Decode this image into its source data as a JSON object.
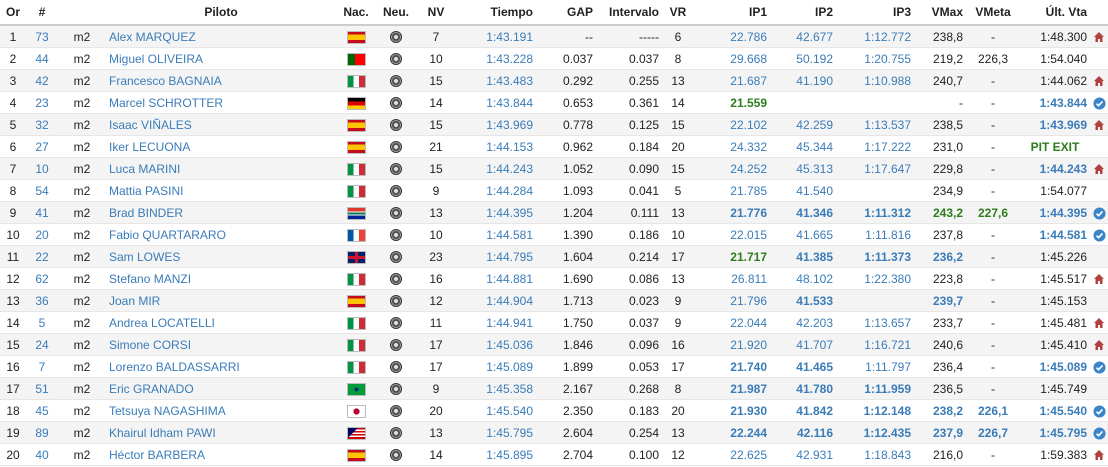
{
  "columns": [
    "Or",
    "#",
    "",
    "Piloto",
    "Nac.",
    "Neu.",
    "NV",
    "Tiempo",
    "GAP",
    "Intervalo",
    "VR",
    "IP1",
    "IP2",
    "IP3",
    "VMax",
    "VMeta",
    "Últ. Vta",
    ""
  ],
  "flags": {
    "SPA": "linear-gradient(#c60b1e 0 25%, #ffc400 25% 75%, #c60b1e 75%)",
    "POR": "linear-gradient(90deg, #006600 0 40%, #ff0000 40%)",
    "ITA": "linear-gradient(90deg, #009246 0 33%, #ffffff 33% 66%, #ce2b37 66%)",
    "GER": "linear-gradient(#000000 0 33%, #dd0000 33% 66%, #ffce00 66%)",
    "RSA": "linear-gradient(#de3831 0 33%, #ffffff 33% 40%, #007a4d 40% 60%, #ffffff 60% 67%, #002395 67%)",
    "FRA": "linear-gradient(90deg, #0055a4 0 33%, #ffffff 33% 66%, #ef4135 66%)",
    "GBR": "linear-gradient(90deg, transparent 42%, #cf142b 42% 58%, transparent 58%), linear-gradient(transparent 38%, #cf142b 38% 62%, transparent 62%), #012169",
    "BRA": "radial-gradient(circle, #002776 0 18%, transparent 19%), linear-gradient(#009b3a, #009b3a)",
    "JPN": "radial-gradient(circle, #bc002d 0 30%, #ffffff 31%)",
    "MAS": "linear-gradient(135deg, #010066 0 35%, transparent 35%), repeating-linear-gradient(#cc0001 0 14%, #ffffff 14% 28%)"
  },
  "icon_colors": {
    "home": "#b0413e",
    "check": "#3a85c7"
  },
  "rows": [
    {
      "pos": "1",
      "num": "73",
      "cat": "m2",
      "rider": "Alex MARQUEZ",
      "nat": "SPA",
      "laps": "7",
      "time": "1:43.191",
      "gap": "--",
      "int": "-----",
      "vr": "6",
      "ip1": "22.786",
      "ip2": "42.677",
      "ip3": "1:12.772",
      "vmax": "238,8",
      "vmeta": "-",
      "last": "1:48.300",
      "icon": "home"
    },
    {
      "pos": "2",
      "num": "44",
      "cat": "m2",
      "rider": "Miguel OLIVEIRA",
      "nat": "POR",
      "laps": "10",
      "time": "1:43.228",
      "gap": "0.037",
      "int": "0.037",
      "vr": "8",
      "ip1": "29.668",
      "ip2": "50.192",
      "ip3": "1:20.755",
      "vmax": "219,2",
      "vmeta": "226,3",
      "last": "1:54.040",
      "icon": ""
    },
    {
      "pos": "3",
      "num": "42",
      "cat": "m2",
      "rider": "Francesco BAGNAIA",
      "nat": "ITA",
      "laps": "15",
      "time": "1:43.483",
      "gap": "0.292",
      "int": "0.255",
      "vr": "13",
      "ip1": "21.687",
      "ip2": "41.190",
      "ip3": "1:10.988",
      "vmax": "240,7",
      "vmeta": "-",
      "last": "1:44.062",
      "icon": "home"
    },
    {
      "pos": "4",
      "num": "23",
      "cat": "m2",
      "rider": "Marcel SCHROTTER",
      "nat": "GER",
      "laps": "14",
      "time": "1:43.844",
      "gap": "0.653",
      "int": "0.361",
      "vr": "14",
      "ip1": "21.559",
      "ip2": "",
      "ip3": "",
      "vmax": "-",
      "vmeta": "-",
      "last": "1:43.844",
      "icon": "check",
      "b_ip1": true,
      "o_last": true
    },
    {
      "pos": "5",
      "num": "32",
      "cat": "m2",
      "rider": "Isaac VIÑALES",
      "nat": "SPA",
      "laps": "15",
      "time": "1:43.969",
      "gap": "0.778",
      "int": "0.125",
      "vr": "15",
      "ip1": "22.102",
      "ip2": "42.259",
      "ip3": "1:13.537",
      "vmax": "238,5",
      "vmeta": "-",
      "last": "1:43.969",
      "icon": "home",
      "o_last": true
    },
    {
      "pos": "6",
      "num": "27",
      "cat": "m2",
      "rider": "Iker LECUONA",
      "nat": "SPA",
      "laps": "21",
      "time": "1:44.153",
      "gap": "0.962",
      "int": "0.184",
      "vr": "20",
      "ip1": "24.332",
      "ip2": "45.344",
      "ip3": "1:17.222",
      "vmax": "231,0",
      "vmeta": "-",
      "last": "PIT EXIT",
      "icon": "",
      "pit": true
    },
    {
      "pos": "7",
      "num": "10",
      "cat": "m2",
      "rider": "Luca MARINI",
      "nat": "ITA",
      "laps": "15",
      "time": "1:44.243",
      "gap": "1.052",
      "int": "0.090",
      "vr": "15",
      "ip1": "24.252",
      "ip2": "45.313",
      "ip3": "1:17.647",
      "vmax": "229,8",
      "vmeta": "-",
      "last": "1:44.243",
      "icon": "home",
      "o_last": true
    },
    {
      "pos": "8",
      "num": "54",
      "cat": "m2",
      "rider": "Mattia PASINI",
      "nat": "ITA",
      "laps": "9",
      "time": "1:44.284",
      "gap": "1.093",
      "int": "0.041",
      "vr": "5",
      "ip1": "21.785",
      "ip2": "41.540",
      "ip3": "",
      "vmax": "234,9",
      "vmeta": "-",
      "last": "1:54.077",
      "icon": ""
    },
    {
      "pos": "9",
      "num": "41",
      "cat": "m2",
      "rider": "Brad BINDER",
      "nat": "RSA",
      "laps": "13",
      "time": "1:44.395",
      "gap": "1.204",
      "int": "0.111",
      "vr": "13",
      "ip1": "21.776",
      "ip2": "41.346",
      "ip3": "1:11.312",
      "vmax": "243,2",
      "vmeta": "227,6",
      "last": "1:44.395",
      "icon": "check",
      "o_ip1": true,
      "o_ip2": true,
      "o_ip3": true,
      "b_vmax": true,
      "b_vmeta": true,
      "o_last": true
    },
    {
      "pos": "10",
      "num": "20",
      "cat": "m2",
      "rider": "Fabio QUARTARARO",
      "nat": "FRA",
      "laps": "10",
      "time": "1:44.581",
      "gap": "1.390",
      "int": "0.186",
      "vr": "10",
      "ip1": "22.015",
      "ip2": "41.665",
      "ip3": "1:11.816",
      "vmax": "237,8",
      "vmeta": "-",
      "last": "1:44.581",
      "icon": "check",
      "o_last": true
    },
    {
      "pos": "11",
      "num": "22",
      "cat": "m2",
      "rider": "Sam LOWES",
      "nat": "GBR",
      "laps": "23",
      "time": "1:44.795",
      "gap": "1.604",
      "int": "0.214",
      "vr": "17",
      "ip1": "21.717",
      "ip2": "41.385",
      "ip3": "1:11.373",
      "vmax": "236,2",
      "vmeta": "-",
      "last": "1:45.226",
      "icon": "",
      "b_ip1": true,
      "o_ip2": true,
      "o_ip3": true,
      "o_vmax": true
    },
    {
      "pos": "12",
      "num": "62",
      "cat": "m2",
      "rider": "Stefano MANZI",
      "nat": "ITA",
      "laps": "16",
      "time": "1:44.881",
      "gap": "1.690",
      "int": "0.086",
      "vr": "13",
      "ip1": "26.811",
      "ip2": "48.102",
      "ip3": "1:22.380",
      "vmax": "223,8",
      "vmeta": "-",
      "last": "1:45.517",
      "icon": "home"
    },
    {
      "pos": "13",
      "num": "36",
      "cat": "m2",
      "rider": "Joan MIR",
      "nat": "SPA",
      "laps": "12",
      "time": "1:44.904",
      "gap": "1.713",
      "int": "0.023",
      "vr": "9",
      "ip1": "21.796",
      "ip2": "41.533",
      "ip3": "",
      "vmax": "239,7",
      "vmeta": "-",
      "last": "1:45.153",
      "icon": "",
      "o_ip2": true,
      "o_vmax": true
    },
    {
      "pos": "14",
      "num": "5",
      "cat": "m2",
      "rider": "Andrea LOCATELLI",
      "nat": "ITA",
      "laps": "11",
      "time": "1:44.941",
      "gap": "1.750",
      "int": "0.037",
      "vr": "9",
      "ip1": "22.044",
      "ip2": "42.203",
      "ip3": "1:13.657",
      "vmax": "233,7",
      "vmeta": "-",
      "last": "1:45.481",
      "icon": "home"
    },
    {
      "pos": "15",
      "num": "24",
      "cat": "m2",
      "rider": "Simone CORSI",
      "nat": "ITA",
      "laps": "17",
      "time": "1:45.036",
      "gap": "1.846",
      "int": "0.096",
      "vr": "16",
      "ip1": "21.920",
      "ip2": "41.707",
      "ip3": "1:16.721",
      "vmax": "240,6",
      "vmeta": "-",
      "last": "1:45.410",
      "icon": "home"
    },
    {
      "pos": "16",
      "num": "7",
      "cat": "m2",
      "rider": "Lorenzo BALDASSARRI",
      "nat": "ITA",
      "laps": "17",
      "time": "1:45.089",
      "gap": "1.899",
      "int": "0.053",
      "vr": "17",
      "ip1": "21.740",
      "ip2": "41.465",
      "ip3": "1:11.797",
      "vmax": "236,4",
      "vmeta": "-",
      "last": "1:45.089",
      "icon": "check",
      "o_ip1": true,
      "o_ip2": true,
      "o_last": true
    },
    {
      "pos": "17",
      "num": "51",
      "cat": "m2",
      "rider": "Eric GRANADO",
      "nat": "BRA",
      "laps": "9",
      "time": "1:45.358",
      "gap": "2.167",
      "int": "0.268",
      "vr": "8",
      "ip1": "21.987",
      "ip2": "41.780",
      "ip3": "1:11.959",
      "vmax": "236,5",
      "vmeta": "-",
      "last": "1:45.749",
      "icon": "",
      "o_ip1": true,
      "o_ip2": true,
      "o_ip3": true
    },
    {
      "pos": "18",
      "num": "45",
      "cat": "m2",
      "rider": "Tetsuya NAGASHIMA",
      "nat": "JPN",
      "laps": "20",
      "time": "1:45.540",
      "gap": "2.350",
      "int": "0.183",
      "vr": "20",
      "ip1": "21.930",
      "ip2": "41.842",
      "ip3": "1:12.148",
      "vmax": "238,2",
      "vmeta": "226,1",
      "last": "1:45.540",
      "icon": "check",
      "o_ip1": true,
      "o_ip2": true,
      "o_ip3": true,
      "o_vmax": true,
      "o_vmeta": true,
      "o_last": true
    },
    {
      "pos": "19",
      "num": "89",
      "cat": "m2",
      "rider": "Khairul Idham PAWI",
      "nat": "MAS",
      "laps": "13",
      "time": "1:45.795",
      "gap": "2.604",
      "int": "0.254",
      "vr": "13",
      "ip1": "22.244",
      "ip2": "42.116",
      "ip3": "1:12.435",
      "vmax": "237,9",
      "vmeta": "226,7",
      "last": "1:45.795",
      "icon": "check",
      "o_ip1": true,
      "o_ip2": true,
      "o_ip3": true,
      "o_vmax": true,
      "o_vmeta": true,
      "o_last": true
    },
    {
      "pos": "20",
      "num": "40",
      "cat": "m2",
      "rider": "Héctor BARBERA",
      "nat": "SPA",
      "laps": "14",
      "time": "1:45.895",
      "gap": "2.704",
      "int": "0.100",
      "vr": "12",
      "ip1": "22.625",
      "ip2": "42.931",
      "ip3": "1:18.843",
      "vmax": "216,0",
      "vmeta": "-",
      "last": "1:59.383",
      "icon": "home"
    }
  ]
}
